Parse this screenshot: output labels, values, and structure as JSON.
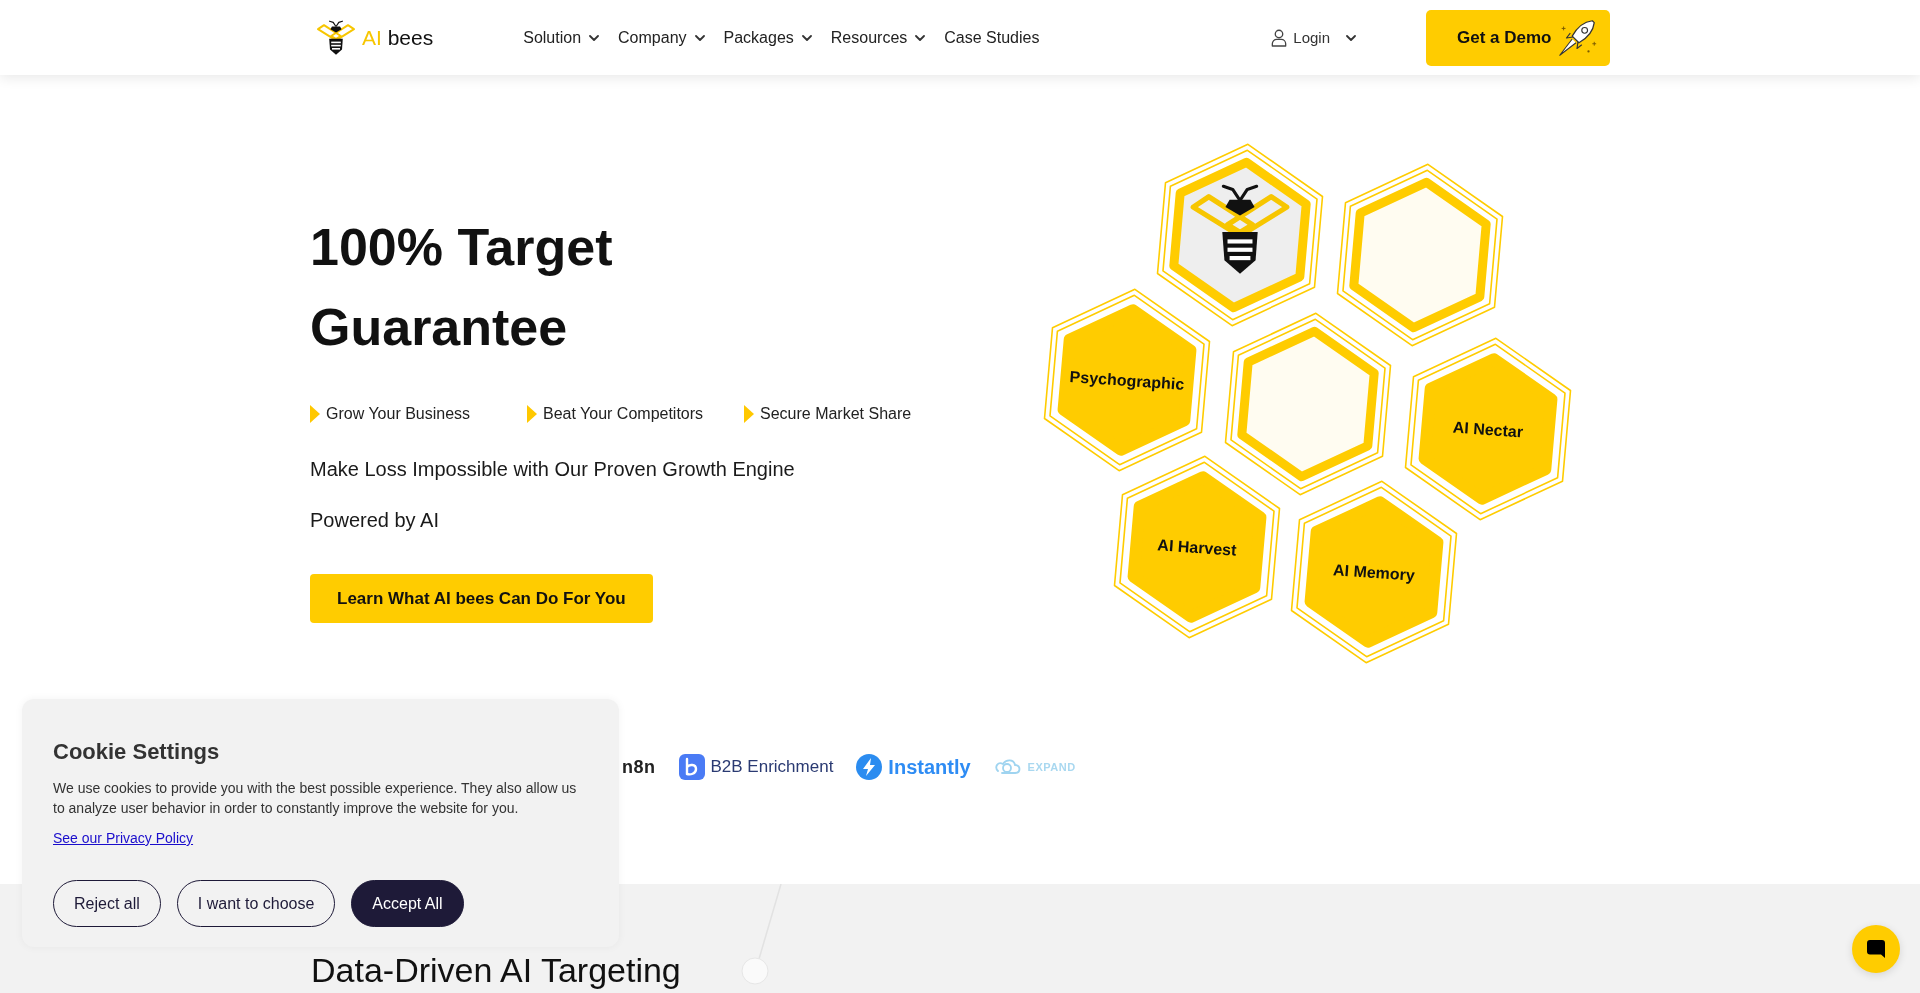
{
  "header": {
    "logo": {
      "accent": "AI",
      "name": "bees"
    },
    "nav": [
      {
        "label": "Solution",
        "has_menu": true
      },
      {
        "label": "Company",
        "has_menu": true
      },
      {
        "label": "Packages",
        "has_menu": true
      },
      {
        "label": "Resources",
        "has_menu": true
      },
      {
        "label": "Case Studies",
        "has_menu": false
      }
    ],
    "login": {
      "label": "Login",
      "has_menu": true
    },
    "cta": {
      "label": "Get a Demo"
    }
  },
  "hero": {
    "title": "100% Target Guarantee",
    "bullets": [
      "Grow Your Business",
      "Beat Your Competitors",
      "Secure Market Share"
    ],
    "tagline": "Make Loss Impossible with Our Proven Growth Engine",
    "subtitle": "Powered by AI",
    "button": "Learn What AI bees Can Do For You",
    "honeycomb": [
      {
        "kind": "logo"
      },
      {
        "kind": "empty"
      },
      {
        "kind": "label",
        "label": "Psychographic"
      },
      {
        "kind": "empty"
      },
      {
        "kind": "label",
        "label": "AI Nectar"
      },
      {
        "kind": "label",
        "label": "AI Harvest"
      },
      {
        "kind": "label",
        "label": "AI Memory"
      }
    ]
  },
  "partners": [
    {
      "kind": "wordmark",
      "name": "n8n"
    },
    {
      "kind": "tile",
      "name": "B2B Enrichment"
    },
    {
      "kind": "bolt",
      "name": "Instantly"
    },
    {
      "kind": "loop",
      "name": "EXPAND"
    }
  ],
  "section": {
    "title": "Data-Driven AI Targeting"
  },
  "cookie_banner": {
    "title": "Cookie Settings",
    "text": "We use cookies to provide you with the best possible experience. They also allow us to analyze user behavior in order to constantly improve the website for you.",
    "link": "See our Privacy Policy",
    "buttons": [
      {
        "label": "Reject all",
        "kind": "outline"
      },
      {
        "label": "I want to choose",
        "kind": "outline"
      },
      {
        "label": "Accept All",
        "kind": "primary"
      }
    ]
  }
}
